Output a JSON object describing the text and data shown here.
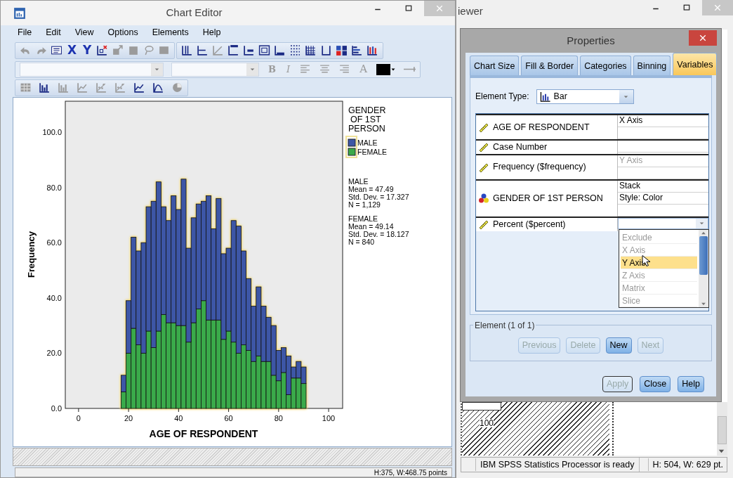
{
  "chart_editor": {
    "title": "Chart Editor",
    "menu": [
      "File",
      "Edit",
      "View",
      "Options",
      "Elements",
      "Help"
    ],
    "toolbar_1": [
      {
        "kind": "undo",
        "disabled": true
      },
      {
        "kind": "redo",
        "disabled": true
      },
      {
        "kind": "list",
        "disabled": false
      },
      {
        "kind": "letter",
        "label": "X",
        "disabled": false
      },
      {
        "kind": "letter",
        "label": "Y",
        "disabled": false
      },
      {
        "kind": "scale",
        "disabled": false
      },
      {
        "kind": "resize",
        "disabled": true
      },
      {
        "kind": "frame",
        "disabled": true
      },
      {
        "kind": "lasso",
        "disabled": true
      },
      {
        "kind": "box",
        "disabled": true
      },
      {
        "kind": "sep"
      },
      {
        "kind": "yaxis",
        "disabled": false
      },
      {
        "kind": "xaxis",
        "disabled": false
      },
      {
        "kind": "diag",
        "disabled": true
      },
      {
        "kind": "title",
        "disabled": false
      },
      {
        "kind": "legend",
        "disabled": false
      },
      {
        "kind": "textbox",
        "disabled": false
      },
      {
        "kind": "footnote",
        "disabled": false
      },
      {
        "kind": "gridpoints",
        "disabled": false
      },
      {
        "kind": "grid",
        "disabled": false
      },
      {
        "kind": "frameaxis",
        "disabled": false
      },
      {
        "kind": "colors",
        "disabled": false
      },
      {
        "kind": "hbars",
        "disabled": false
      },
      {
        "kind": "vbars",
        "disabled": false
      }
    ],
    "toolbar_2": [
      {
        "kind": "combo",
        "disabled": true
      },
      {
        "kind": "combo",
        "disabled": true
      },
      {
        "kind": "bold",
        "label": "B",
        "disabled": true
      },
      {
        "kind": "italic",
        "label": "I",
        "disabled": true
      },
      {
        "kind": "align-left",
        "disabled": true
      },
      {
        "kind": "align-center",
        "disabled": true
      },
      {
        "kind": "align-right",
        "disabled": true
      },
      {
        "kind": "textcolor",
        "label": "A",
        "disabled": true
      },
      {
        "kind": "swatch",
        "color": "#000000"
      },
      {
        "kind": "linestyle",
        "disabled": true
      }
    ],
    "toolbar_3": [
      {
        "kind": "table",
        "disabled": true
      },
      {
        "kind": "bars",
        "disabled": false
      },
      {
        "kind": "bars",
        "disabled": true
      },
      {
        "kind": "line",
        "disabled": true
      },
      {
        "kind": "scatter",
        "disabled": true
      },
      {
        "kind": "scatter",
        "disabled": true
      },
      {
        "kind": "line",
        "disabled": false
      },
      {
        "kind": "curve",
        "disabled": false
      },
      {
        "kind": "pie",
        "disabled": true
      }
    ],
    "chart": {
      "element_selected": true,
      "chart_data": {
        "type": "bar",
        "stacked": true,
        "xlabel": "AGE OF RESPONDENT",
        "ylabel": "Frequency",
        "x": [
          18,
          20,
          22,
          24,
          26,
          28,
          30,
          32,
          34,
          36,
          38,
          40,
          42,
          44,
          46,
          48,
          50,
          52,
          54,
          56,
          58,
          60,
          62,
          64,
          66,
          68,
          70,
          72,
          74,
          76,
          78,
          80,
          82,
          84,
          86,
          88,
          90
        ],
        "series": [
          {
            "name": "FEMALE",
            "color": "#3aaa4a",
            "values": [
              6,
              20,
              29,
              23,
              20,
              28,
              22,
              28,
              34,
              31,
              31,
              30,
              30,
              24,
              31,
              36,
              39,
              32,
              32,
              32,
              25,
              28,
              24,
              20,
              23,
              21,
              17,
              19,
              17,
              17,
              12,
              10,
              13,
              5,
              11,
              11,
              9
            ]
          },
          {
            "name": "MALE",
            "color": "#3d56a6",
            "values": [
              6,
              19,
              33,
              34,
              40,
              45,
              53,
              54,
              39,
              37,
              46,
              42,
              53,
              34,
              38,
              38,
              36,
              45,
              33,
              44,
              31,
              30,
              44,
              46,
              34,
              26,
              20,
              25,
              20,
              16,
              18,
              11,
              9,
              14,
              4,
              6,
              6
            ]
          }
        ],
        "xlim": [
          -5.3,
          105.6
        ],
        "ylim": [
          0,
          111.2
        ],
        "xticks": [
          0,
          20,
          40,
          60,
          80,
          100
        ],
        "yticks": [
          {
            "value": 0,
            "label": "0.0"
          },
          {
            "value": 20,
            "label": "20.0"
          },
          {
            "value": 40,
            "label": "40.0"
          },
          {
            "value": 60,
            "label": "60.0"
          },
          {
            "value": 80,
            "label": "80.0"
          },
          {
            "value": 100,
            "label": "100.0"
          }
        ],
        "legend": {
          "title": [
            "GENDER",
            "OF 1ST",
            "PERSON"
          ],
          "selected": true
        }
      },
      "stats": [
        {
          "group": "MALE",
          "lines": [
            "Mean = 47.49",
            "Std. Dev. = 17.327",
            "N = 1,129"
          ]
        },
        {
          "group": "FEMALE",
          "lines": [
            "Mean = 49.14",
            "Std. Dev. = 18.127",
            "N = 840"
          ]
        }
      ]
    },
    "status": "H:375, W:468.75 points"
  },
  "viewer": {
    "title": "iewer",
    "axis_label": "100",
    "status": [
      "IBM SPSS Statistics Processor is ready",
      "H: 504, W: 629 pt."
    ]
  },
  "properties": {
    "title": "Properties",
    "tabs": [
      {
        "label": "Chart Size",
        "selected": false
      },
      {
        "label": "Fill & Border",
        "selected": false
      },
      {
        "label": "Categories",
        "selected": false
      },
      {
        "label": "Binning",
        "selected": false
      },
      {
        "label": "Variables",
        "selected": true
      }
    ],
    "element_type": {
      "label": "Element Type:",
      "value": "Bar"
    },
    "variables": [
      {
        "name": "AGE OF RESPONDENT",
        "kind": "scale",
        "values": [
          {
            "text": "X Axis",
            "disabled": false
          }
        ]
      },
      {
        "name": "Case Number",
        "kind": "scale"
      },
      {
        "name": "Frequency ($frequency)",
        "kind": "scale",
        "values": [
          {
            "text": "Y Axis",
            "disabled": true
          }
        ]
      },
      {
        "name": "GENDER OF 1ST PERSON",
        "kind": "nominal",
        "values": [
          {
            "text": "Stack",
            "disabled": false
          },
          {
            "text": "Style: Color",
            "disabled": false
          }
        ]
      },
      {
        "name": "Percent ($percent)",
        "kind": "scale",
        "options": [
          {
            "label": "Exclude",
            "disabled": true,
            "selected": false
          },
          {
            "label": "X Axis",
            "disabled": true,
            "selected": false
          },
          {
            "label": "Y Axis",
            "disabled": false,
            "selected": true
          },
          {
            "label": "Z Axis",
            "disabled": true,
            "selected": false
          },
          {
            "label": "Matrix",
            "disabled": true,
            "selected": false
          },
          {
            "label": "Slice",
            "disabled": true,
            "selected": false
          }
        ]
      }
    ],
    "element_group": {
      "label": "Element (1 of 1)",
      "buttons": [
        {
          "label": "Previous",
          "disabled": true
        },
        {
          "label": "Delete",
          "disabled": true
        },
        {
          "label": "New",
          "disabled": false
        },
        {
          "label": "Next",
          "disabled": true
        }
      ]
    },
    "buttons": [
      {
        "label": "Apply",
        "disabled": true
      },
      {
        "label": "Close",
        "disabled": false
      },
      {
        "label": "Help",
        "disabled": false
      }
    ]
  }
}
